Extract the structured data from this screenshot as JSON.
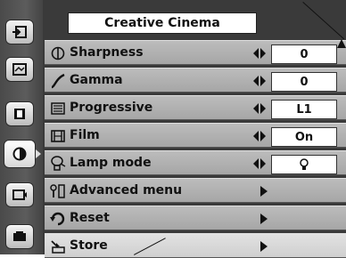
{
  "menu": {
    "title": "Creative Cinema",
    "items": [
      {
        "label": "Sharpness",
        "icon": "sharpness-icon",
        "value": "0"
      },
      {
        "label": "Gamma",
        "icon": "gamma-icon",
        "value": "0"
      },
      {
        "label": "Progressive",
        "icon": "progressive-icon",
        "value": "L1"
      },
      {
        "label": "Film",
        "icon": "film-icon",
        "value": "On"
      },
      {
        "label": "Lamp mode",
        "icon": "lamp-mode-icon",
        "value_icon": "lamp-bulb-icon"
      },
      {
        "label": "Advanced menu",
        "icon": "advanced-menu-icon"
      },
      {
        "label": "Reset",
        "icon": "reset-icon"
      },
      {
        "label": "Store",
        "icon": "store-icon"
      }
    ]
  },
  "sidebar": {
    "items": [
      {
        "icon": "input-icon"
      },
      {
        "icon": "computer-adjust-icon"
      },
      {
        "icon": "image-select-icon"
      },
      {
        "icon": "image-adjust-icon",
        "active": true
      },
      {
        "icon": "screen-icon"
      },
      {
        "icon": "setting-icon"
      },
      {
        "icon": "information-icon"
      }
    ]
  }
}
